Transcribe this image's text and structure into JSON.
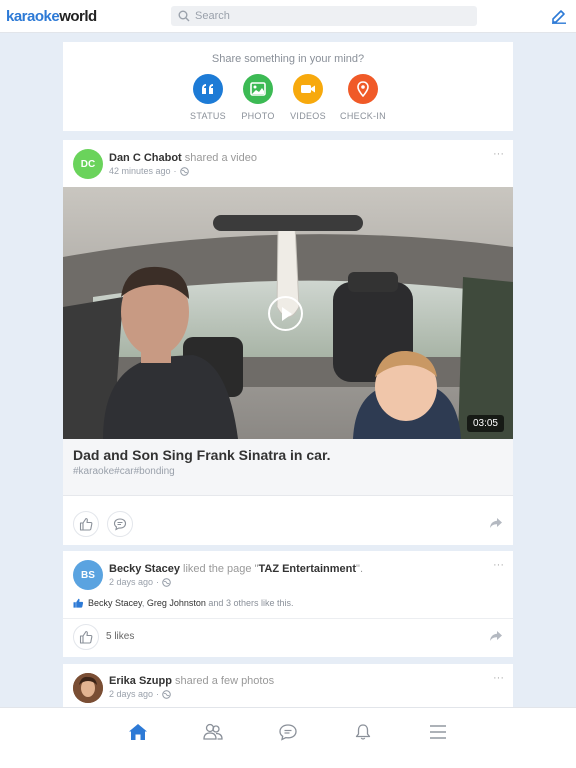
{
  "app": {
    "logo_part1": "karaoke",
    "logo_part2": "world",
    "search_placeholder": "Search",
    "accent": "#2d7ad6"
  },
  "composer": {
    "prompt": "Share something in your mind?",
    "buttons": [
      {
        "label": "STATUS",
        "icon": "quote-icon",
        "color": "#1d7bd6"
      },
      {
        "label": "PHOTO",
        "icon": "image-icon",
        "color": "#3cba54"
      },
      {
        "label": "VIDEOS",
        "icon": "video-camera-icon",
        "color": "#f7a90d"
      },
      {
        "label": "CHECK-IN",
        "icon": "location-pin-icon",
        "color": "#f05a28"
      }
    ]
  },
  "posts": [
    {
      "avatar_initials": "DC",
      "avatar_color": "#6ad35b",
      "author": "Dan C Chabot",
      "action": " shared a video",
      "time": "42 minutes ago",
      "privacy_icon": "globe-icon",
      "more": "···",
      "video": {
        "title": "Dad and Son Sing Frank Sinatra in car.",
        "tags": "#karaoke#car#bonding",
        "duration": "03:05"
      }
    },
    {
      "avatar_initials": "BS",
      "avatar_color": "#5aa3e0",
      "author": "Becky Stacey",
      "action_pre": " liked the page \"",
      "page": "TAZ Entertainment",
      "action_post": "\".",
      "time": "2 days ago",
      "privacy_icon": "globe-icon",
      "more": "···",
      "likers_1": "Becky Stacey",
      "likers_sep": ", ",
      "likers_2": "Greg Johnston",
      "likers_rest": " and 3 others like this.",
      "likes_count": "5 likes"
    },
    {
      "author": "Erika Szupp",
      "action": " shared a few photos",
      "time": "2 days ago",
      "privacy_icon": "globe-icon",
      "more": "···"
    }
  ],
  "bottom_nav": [
    {
      "name": "home-icon",
      "active": true
    },
    {
      "name": "friends-icon",
      "active": false
    },
    {
      "name": "chat-icon",
      "active": false
    },
    {
      "name": "bell-icon",
      "active": false
    },
    {
      "name": "menu-icon",
      "active": false
    }
  ]
}
